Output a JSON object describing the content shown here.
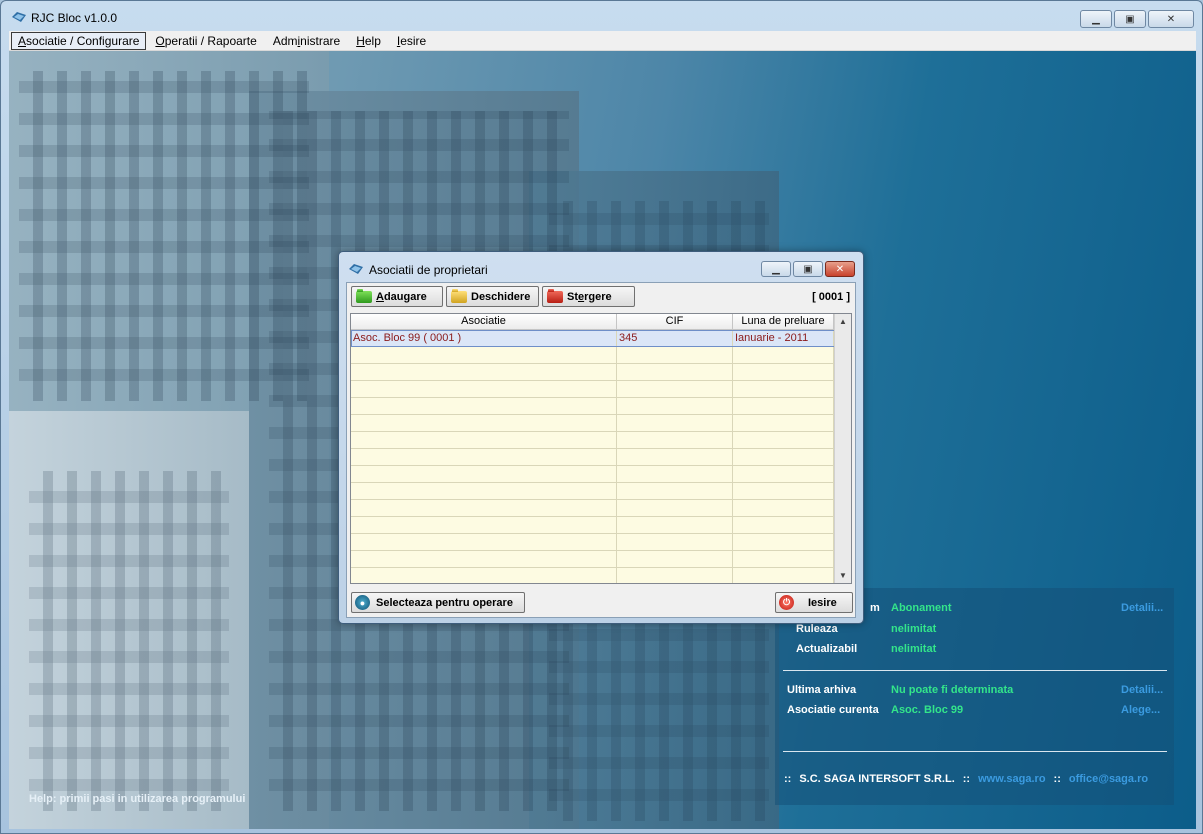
{
  "window": {
    "title": "RJC Bloc v1.0.0"
  },
  "menu": [
    {
      "pre": "",
      "u": "A",
      "post": "sociatie / Configurare"
    },
    {
      "pre": "",
      "u": "O",
      "post": "peratii / Rapoarte"
    },
    {
      "pre": "Adm",
      "u": "i",
      "post": "nistrare"
    },
    {
      "pre": "",
      "u": "H",
      "post": "elp"
    },
    {
      "pre": "",
      "u": "I",
      "post": "esire"
    }
  ],
  "help_text": "Help: primii pasi in utilizarea programului",
  "dialog": {
    "title": "Asociatii de proprietari",
    "add_u": "A",
    "add_rest": "daugare",
    "open_label": "Deschidere",
    "del_pre": "St",
    "del_u": "e",
    "del_post": "rgere",
    "counter": "[ 0001 ]",
    "columns": [
      "Asociatie",
      "CIF",
      "Luna de preluare"
    ],
    "rows": [
      {
        "asociatie": "Asoc. Bloc 99 ( 0001 )",
        "cif": "345",
        "luna": "Ianuarie - 2011"
      }
    ],
    "select_label": "Selecteaza pentru operare",
    "exit_label": "Iesire"
  },
  "info": {
    "program_label_partial": "m",
    "program_value": "Abonament",
    "details_link": "Detalii...",
    "runs_label": "Ruleaza",
    "runs_value": "nelimitat",
    "update_label": "Actualizabil",
    "update_value": "nelimitat",
    "archive_label": "Ultima arhiva",
    "archive_value": "Nu poate fi determinata",
    "archive_link": "Detalii...",
    "current_label": "Asociatie curenta",
    "current_value": "Asoc. Bloc 99",
    "current_link": "Alege...",
    "footer": {
      "sep": "::",
      "company": "S.C. SAGA INTERSOFT S.R.L.",
      "web": "www.saga.ro",
      "email": "office@saga.ro"
    }
  }
}
